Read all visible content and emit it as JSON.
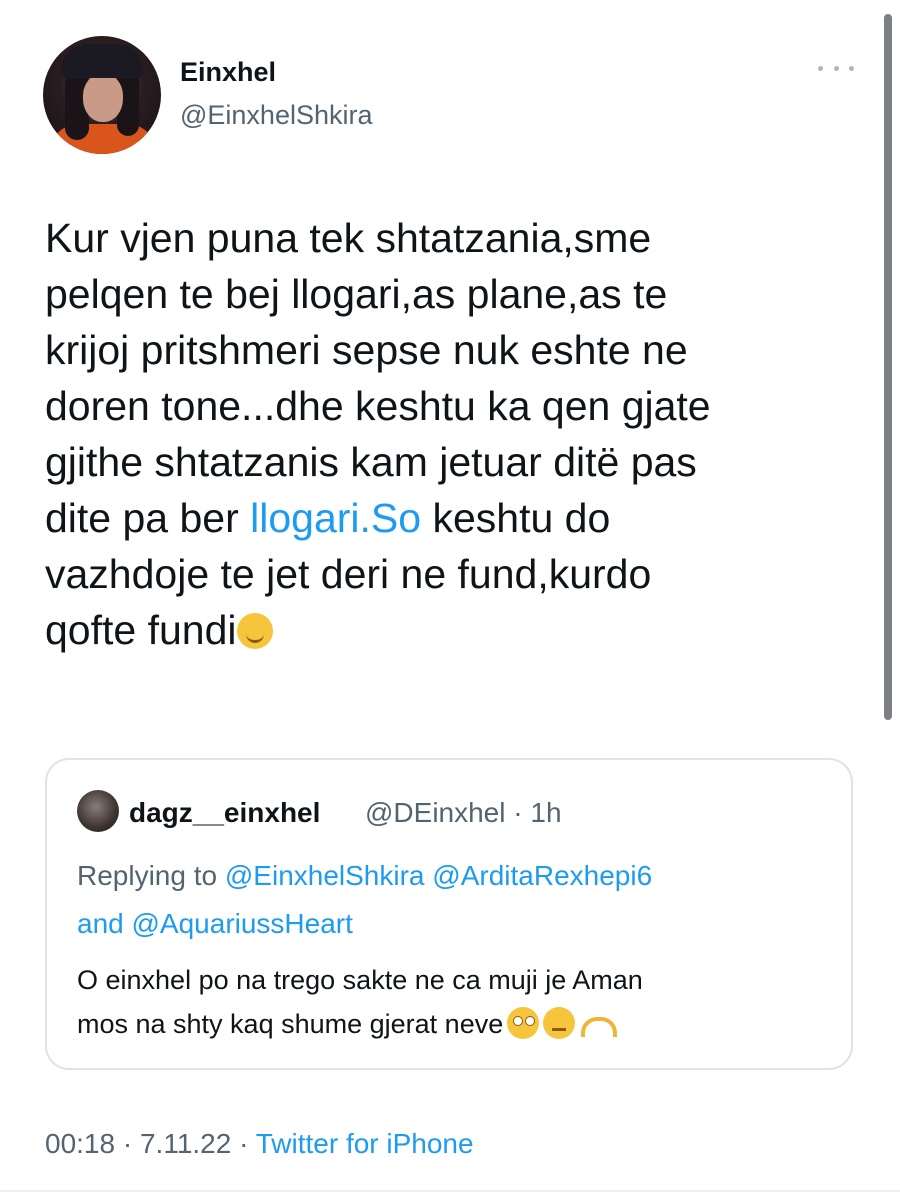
{
  "author": {
    "display_name": "Einxhel",
    "handle": "@EinxhelShkira"
  },
  "tweet": {
    "lines": [
      "Kur vjen puna tek shtatzania,sme",
      "pelqen te bej llogari,as plane,as te",
      "krijoj pritshmeri sepse nuk eshte ne",
      "doren tone...dhe keshtu ka qen gjate",
      "gjithe shtatzanis kam jetuar ditë pas"
    ],
    "line6_before": "dite pa ber ",
    "line6_link": "llogari.So",
    "line6_after": " keshtu do",
    "line7": "vazhdoje te jet deri ne fund,kurdo",
    "line8": "qofte fundi",
    "line8_emoji": "relieved-face-emoji"
  },
  "quoted_tweet": {
    "display_name": "dagz__einxhel",
    "handle": "@DEinxhel",
    "separator": "·",
    "time": "1h",
    "replying_label": "Replying to",
    "replying_to_1": "@EinxhelShkira",
    "replying_to_2": "@ArditaRexhepi6",
    "replying_and": "and",
    "replying_to_3": "@AquariussHeart",
    "text_line1": "O einxhel po na trego sakte ne ca muji je Aman",
    "text_line2": "mos na shty kaq shume gjerat neve",
    "emojis": [
      "face-with-rolling-eyes-emoji",
      "neutral-face-emoji",
      "heart-hands-emoji"
    ]
  },
  "meta": {
    "time": "00:18",
    "dot1": "·",
    "date": "7.11.22",
    "dot2": "·",
    "source": "Twitter for iPhone"
  },
  "colors": {
    "link": "#1d9bf0",
    "secondary_text": "#536471",
    "primary_text": "#0f1419",
    "card_border": "#dfe3e6"
  }
}
